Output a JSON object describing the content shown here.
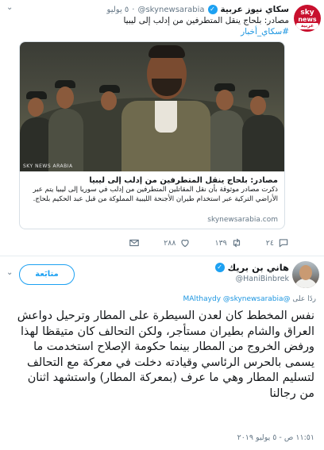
{
  "quoted": {
    "name": "سكاي نيوز عربية",
    "handle": "@skynewsarabia",
    "dot": "·",
    "date": "٥ يوليو",
    "text": "مصادر: بلحاج ينقل المتطرفين من إدلب إلى ليبيا",
    "hashtag": "#سكاي_أخبار",
    "avatar_logo": {
      "top": "sky",
      "middle": "news",
      "bottom": "عربية"
    },
    "card": {
      "watermark": "SKY NEWS ARABIA",
      "title": "مصادر: بلحاج ينقل المتطرفين من إدلب إلى ليبيا",
      "description": "ذكرت مصادر موثوقة بأن نقل المقاتلين المتطرفين من إدلب في سوريا إلى ليبيا يتم عبر الأراضي التركية عبر استخدام طيران الأجنحة الليبية المملوكة من قبل عبد الحكيم بلحاج.",
      "url": "skynewsarabia.com"
    },
    "actions": {
      "replies": "٢٤",
      "retweets": "١٣٩",
      "likes": "٢٨٨"
    }
  },
  "main": {
    "name": "هاني بن بريك",
    "handle": "@HaniBinbrek",
    "follow_label": "متابَعة",
    "reply_prefix": "ردًا على",
    "reply_mentions": "@MAlthaydy @skynewsarabia",
    "text": "نفس المخطط كان لعدن السيطرة على المطار وترحيل دواعش العراق والشام بطيران مستأجر، ولكن التحالف كان متيقظا لهذا ورفض الخروج من المطار بينما حكومة الإصلاح استخدمت ما يسمى بالحرس الرئاسي وقيادته دخلت في معركة مع التحالف لتسليم المطار وهي ما عرف (بمعركة المطار) واستشهد اثنان من رجالنا",
    "timestamp": "١١:٥١ ص - ٥ يوليو ٢٠١٩"
  },
  "colors": {
    "accent": "#1da1f2",
    "link": "#1b95e0",
    "secondary_text": "#657786",
    "sky_red": "#c8102e"
  },
  "icons": [
    "verified-badge-icon",
    "chevron-down-icon",
    "reply-icon",
    "retweet-icon",
    "like-icon",
    "dm-icon"
  ]
}
